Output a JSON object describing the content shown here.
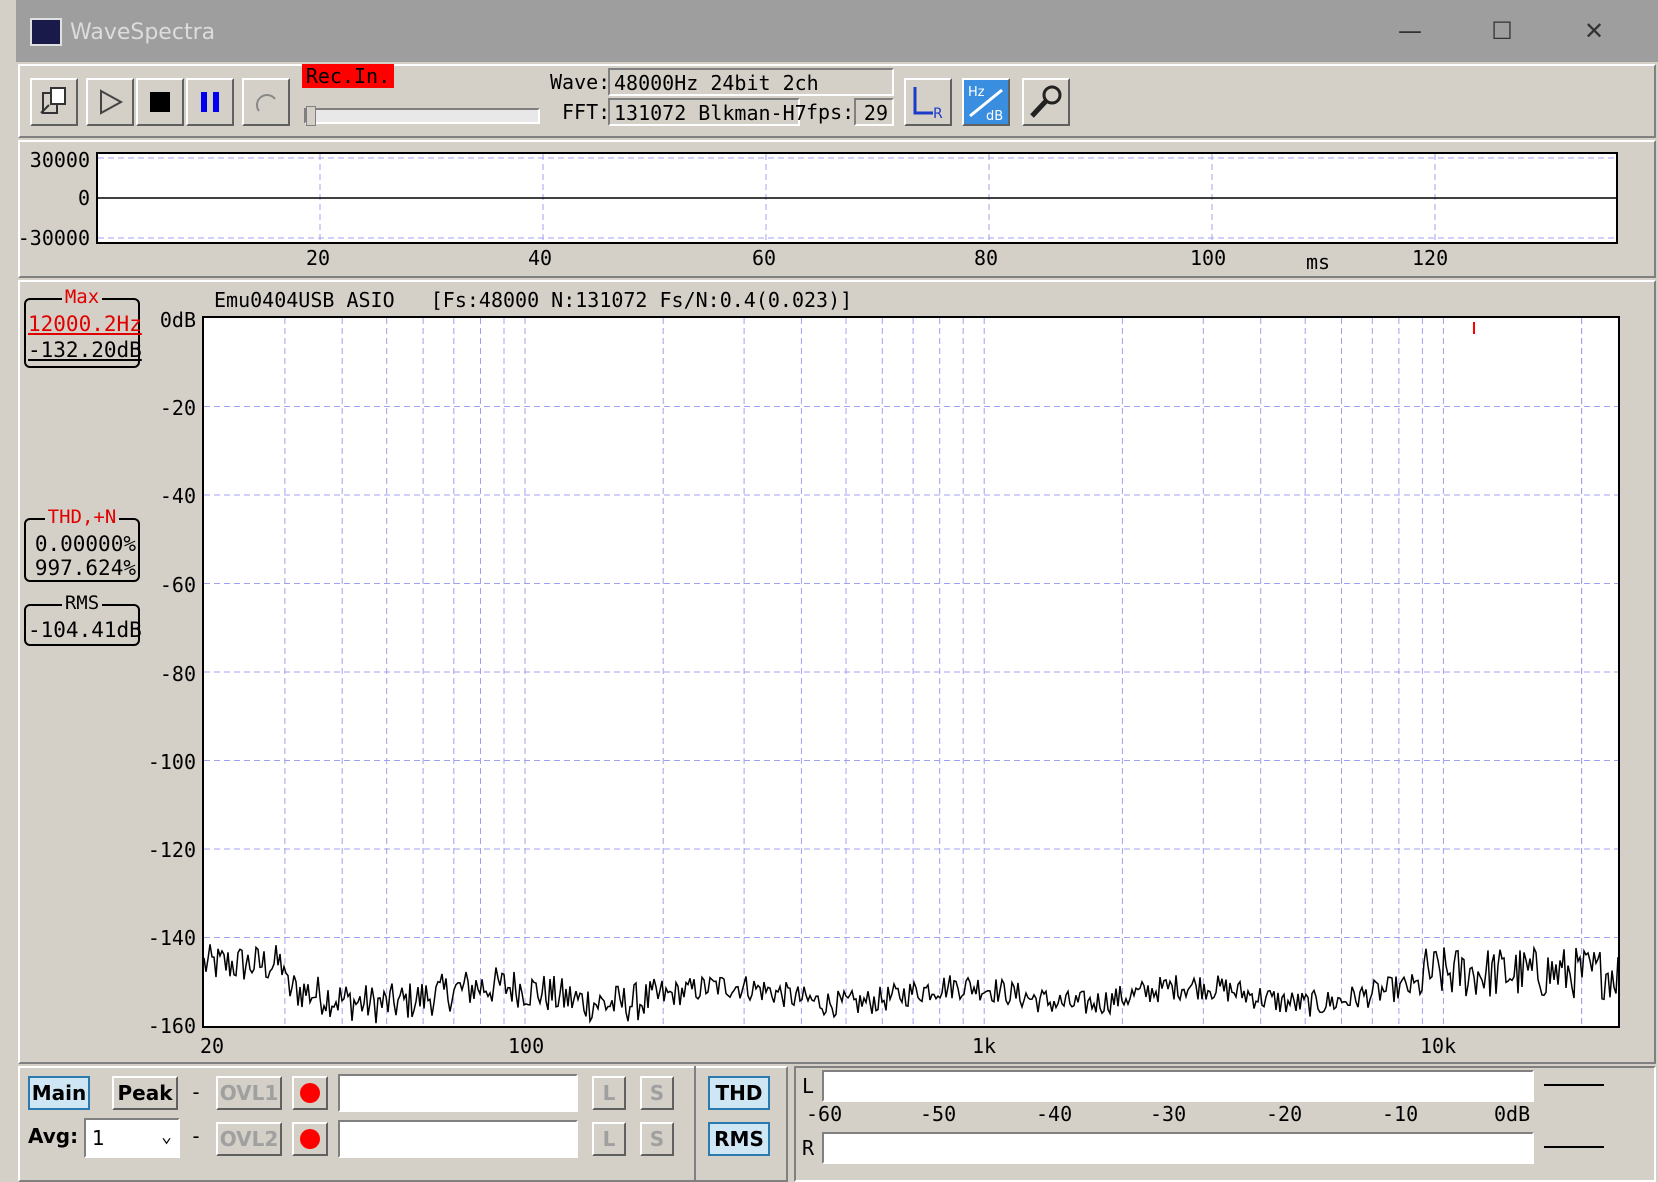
{
  "window": {
    "title": "WaveSpectra",
    "min_glyph": "—",
    "max_glyph": "☐",
    "close_glyph": "✕"
  },
  "toolbar": {
    "rec_label": "Rec.In.",
    "wave_label": "Wave:",
    "wave_value": "48000Hz 24bit 2ch",
    "fft_label": "FFT:",
    "fft_value": "131072 Blkman-H7",
    "fps_label": "fps:",
    "fps_value": "29",
    "icons": [
      "open-file-icon",
      "play-icon",
      "stop-icon",
      "pause-icon",
      "repeat-icon",
      "lr-channel-icon",
      "hz-db-icon",
      "settings-wrench-icon"
    ]
  },
  "waveform": {
    "y_ticks": [
      "30000",
      "0",
      "-30000"
    ],
    "x_ticks": [
      "20",
      "40",
      "60",
      "80",
      "100",
      "120"
    ],
    "x_unit": "ms"
  },
  "spectrum": {
    "device_info": "Emu0404USB ASIO   [Fs:48000 N:131072 Fs/N:0.4(0.023)]",
    "max_caption": "Max",
    "max_freq": "12000.2Hz",
    "max_level": "-132.20dB",
    "thd_caption": "THD,+N",
    "thd_value": "0.00000%",
    "thdn_value": "997.624%",
    "rms_caption": "RMS",
    "rms_value": "-104.41dB",
    "y_ticks": [
      "0dB",
      "-20",
      "-40",
      "-60",
      "-80",
      "-100",
      "-120",
      "-140",
      "-160"
    ],
    "x_ticks": [
      "20",
      "100",
      "1k",
      "10k"
    ],
    "colors": {
      "trace": "#000000",
      "grid": "#a0a0f0",
      "marker": "#ff0000"
    }
  },
  "bottom": {
    "main_label": "Main",
    "peak_label": "Peak",
    "dash": "-",
    "ovl1_label": "OVL1",
    "ovl2_label": "OVL2",
    "l_label": "L",
    "s_label": "S",
    "avg_label": "Avg:",
    "avg_value": "1",
    "thd_button": "THD",
    "rms_button": "RMS"
  },
  "level_meter": {
    "left_label": "L",
    "right_label": "R",
    "scale": [
      "-60",
      "-50",
      "-40",
      "-30",
      "-20",
      "-10",
      "0dB"
    ]
  }
}
